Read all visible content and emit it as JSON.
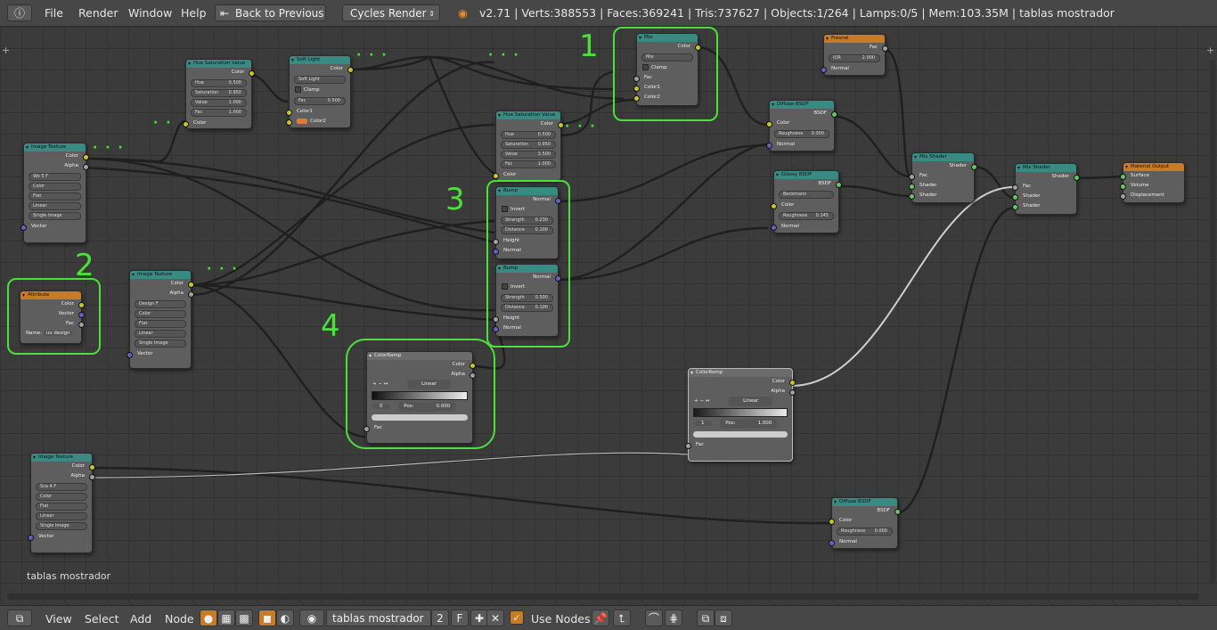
{
  "topbar": {
    "menus": [
      "File",
      "Render",
      "Window",
      "Help"
    ],
    "back_label": "Back to Previous",
    "engine": "Cycles Render",
    "stats": "v2.71 | Verts:388553 | Faces:369241 | Tris:737627 | Objects:1/264 | Lamps:0/5 | Mem:103.35M | tablas mostrador"
  },
  "material_label": "tablas mostrador",
  "annotations": [
    "1",
    "2",
    "3",
    "4"
  ],
  "nodes": {
    "img1": {
      "title": "Image Texture",
      "color_out": "Color",
      "alpha_out": "Alpha",
      "image": "Wo",
      "users": "5",
      "f": "F",
      "opts": [
        "Color",
        "Flat",
        "Linear",
        "Single Image"
      ],
      "vector": "Vector"
    },
    "hsv1": {
      "title": "Hue Saturation Value",
      "color_out": "Color",
      "hue": "Hue",
      "hue_v": "0.500",
      "sat": "Saturation",
      "sat_v": "0.950",
      "val": "Value",
      "val_v": "1.000",
      "fac": "Fac",
      "fac_v": "1.000",
      "color_in": "Color"
    },
    "soft": {
      "title": "Soft Light",
      "color_out": "Color",
      "mode": "Soft Light",
      "clamp": "Clamp",
      "fac": "Fac",
      "fac_v": "0.500",
      "c1": "Color1",
      "c2": "Color2"
    },
    "mix": {
      "title": "Mix",
      "color_out": "Color",
      "mode": "Mix",
      "clamp": "Clamp",
      "fac": "Fac",
      "c1": "Color1",
      "c2": "Color2"
    },
    "fresnel": {
      "title": "Fresnel",
      "fac_out": "Fac",
      "ior": "IOR",
      "ior_v": "2.000",
      "normal": "Normal"
    },
    "hsv2": {
      "title": "Hue Saturation Value",
      "color_out": "Color",
      "hue": "Hue",
      "hue_v": "0.500",
      "sat": "Saturation",
      "sat_v": "0.950",
      "val": "Value",
      "val_v": "3.500",
      "fac": "Fac",
      "fac_v": "1.000",
      "color_in": "Color"
    },
    "diff1": {
      "title": "Diffuse BSDF",
      "bsdf": "BSDF",
      "color": "Color",
      "rough": "Roughness",
      "rough_v": "0.000",
      "normal": "Normal"
    },
    "gloss": {
      "title": "Glossy BSDF",
      "bsdf": "BSDF",
      "dist": "Beckmann",
      "color": "Color",
      "rough": "Roughness",
      "rough_v": "0.145",
      "normal": "Normal"
    },
    "bump1": {
      "title": "Bump",
      "normal_out": "Normal",
      "invert": "Invert",
      "str": "Strength",
      "str_v": "0.230",
      "dist": "Distance",
      "dist_v": "0.100",
      "height": "Height",
      "normal_in": "Normal"
    },
    "bump2": {
      "title": "Bump",
      "normal_out": "Normal",
      "invert": "Invert",
      "str": "Strength",
      "str_v": "0.500",
      "dist": "Distance",
      "dist_v": "0.100",
      "height": "Height",
      "normal_in": "Normal"
    },
    "mixsh1": {
      "title": "Mix Shader",
      "shader_out": "Shader",
      "fac": "Fac",
      "s1": "Shader",
      "s2": "Shader"
    },
    "mixsh2": {
      "title": "Mix Shader",
      "shader_out": "Shader",
      "fac": "Fac",
      "s1": "Shader",
      "s2": "Shader"
    },
    "matout": {
      "title": "Material Output",
      "surface": "Surface",
      "volume": "Volume",
      "disp": "Displacement"
    },
    "attr": {
      "title": "Attribute",
      "color": "Color",
      "vector": "Vector",
      "fac": "Fac",
      "name": "Name:",
      "name_v": "uv design"
    },
    "img2": {
      "title": "Image Texture",
      "color_out": "Color",
      "alpha_out": "Alpha",
      "image": "Design",
      "f": "F",
      "opts": [
        "Color",
        "Flat",
        "Linear",
        "Single Image"
      ],
      "vector": "Vector"
    },
    "ramp1": {
      "title": "ColorRamp",
      "color": "Color",
      "alpha": "Alpha",
      "interp": "Linear",
      "idx": "0",
      "pos": "Pos:",
      "pos_v": "0.000",
      "fac": "Fac"
    },
    "ramp2": {
      "title": "ColorRamp",
      "color": "Color",
      "alpha": "Alpha",
      "interp": "Linear",
      "idx": "1",
      "pos": "Pos:",
      "pos_v": "1.000",
      "fac": "Fac"
    },
    "img3": {
      "title": "Image Texture",
      "color_out": "Color",
      "alpha_out": "Alpha",
      "image": "Sca",
      "users": "4",
      "f": "F",
      "opts": [
        "Color",
        "Flat",
        "Linear",
        "Single Image"
      ],
      "vector": "Vector"
    },
    "diff2": {
      "title": "Diffuse BSDF",
      "bsdf": "BSDF",
      "color": "Color",
      "rough": "Roughness",
      "rough_v": "0.000",
      "normal": "Normal"
    }
  },
  "bottombar": {
    "menus": [
      "View",
      "Select",
      "Add",
      "Node"
    ],
    "material": "tablas mostrador",
    "users": "2",
    "f": "F",
    "use_nodes": "Use Nodes"
  }
}
